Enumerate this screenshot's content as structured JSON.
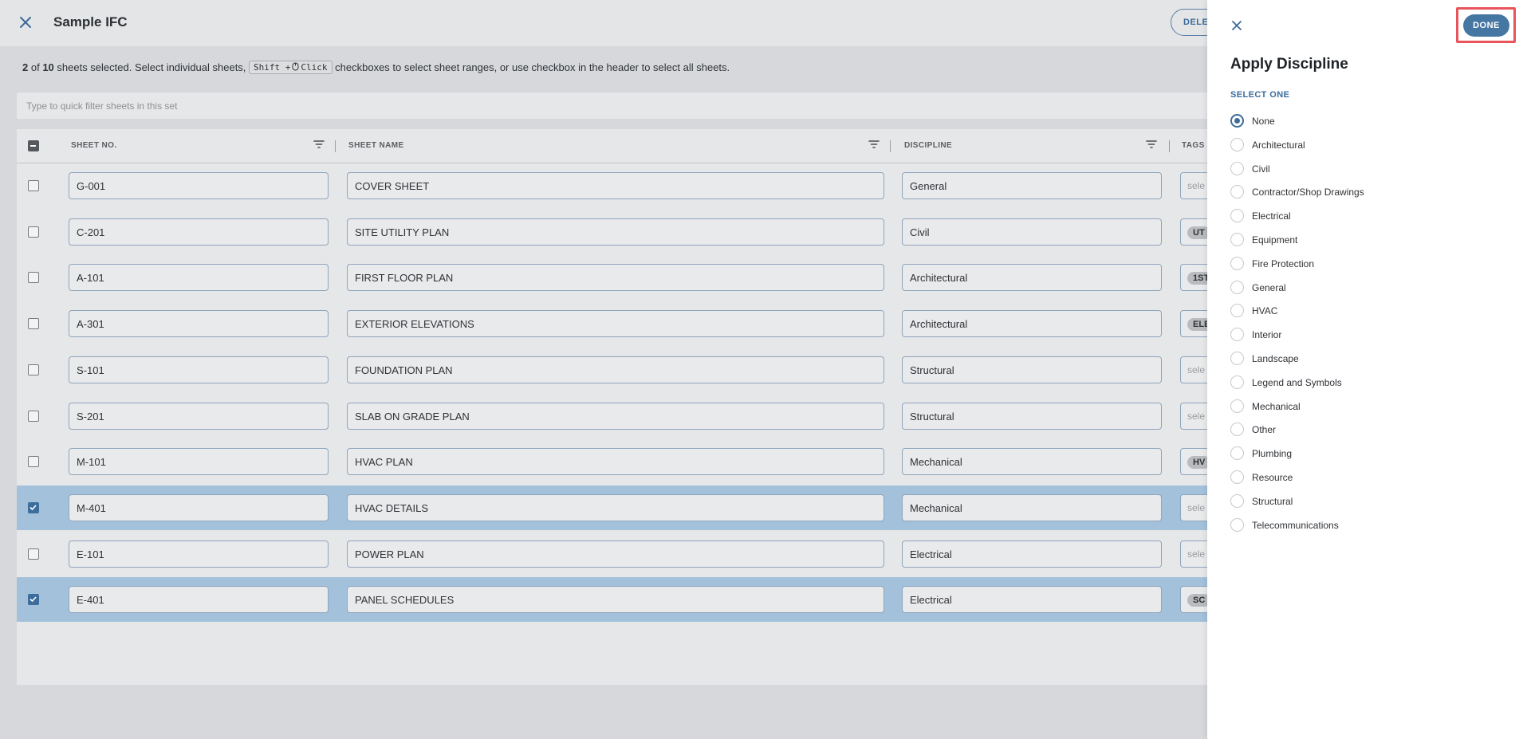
{
  "header": {
    "title": "Sample IFC",
    "delete_label": "DELETE"
  },
  "selection": {
    "selected_count": "2",
    "of_text": " of ",
    "total_count": "10",
    "message_part1": " sheets selected. Select individual sheets, ",
    "kbd_shift": "Shift +",
    "kbd_click": "Click",
    "message_part2": " checkboxes to select sheet ranges, or use checkbox in the header to select all sheets."
  },
  "filter": {
    "placeholder": "Type to quick filter sheets in this set"
  },
  "table": {
    "columns": {
      "sheet_no": "SHEET NO.",
      "sheet_name": "SHEET NAME",
      "discipline": "DISCIPLINE",
      "tags": "TAGS"
    },
    "rows": [
      {
        "no": "G-001",
        "name": "COVER SHEET",
        "discipline": "General",
        "tag": "sele",
        "tag_is_chip": false,
        "selected": false
      },
      {
        "no": "C-201",
        "name": "SITE UTILITY PLAN",
        "discipline": "Civil",
        "tag": "UT",
        "tag_is_chip": true,
        "selected": false
      },
      {
        "no": "A-101",
        "name": "FIRST FLOOR PLAN",
        "discipline": "Architectural",
        "tag": "1ST",
        "tag_is_chip": true,
        "selected": false
      },
      {
        "no": "A-301",
        "name": "EXTERIOR ELEVATIONS",
        "discipline": "Architectural",
        "tag": "ELE",
        "tag_is_chip": true,
        "selected": false
      },
      {
        "no": "S-101",
        "name": "FOUNDATION PLAN",
        "discipline": "Structural",
        "tag": "sele",
        "tag_is_chip": false,
        "selected": false
      },
      {
        "no": "S-201",
        "name": "SLAB ON GRADE PLAN",
        "discipline": "Structural",
        "tag": "sele",
        "tag_is_chip": false,
        "selected": false
      },
      {
        "no": "M-101",
        "name": "HVAC PLAN",
        "discipline": "Mechanical",
        "tag": "HV",
        "tag_is_chip": true,
        "selected": false
      },
      {
        "no": "M-401",
        "name": "HVAC DETAILS",
        "discipline": "Mechanical",
        "tag": "sele",
        "tag_is_chip": false,
        "selected": true
      },
      {
        "no": "E-101",
        "name": "POWER PLAN",
        "discipline": "Electrical",
        "tag": "sele",
        "tag_is_chip": false,
        "selected": false
      },
      {
        "no": "E-401",
        "name": "PANEL SCHEDULES",
        "discipline": "Electrical",
        "tag": "SC",
        "tag_is_chip": true,
        "selected": true
      }
    ]
  },
  "panel": {
    "title": "Apply Discipline",
    "select_one": "SELECT ONE",
    "done_label": "DONE",
    "selected_option": "None",
    "options": [
      "None",
      "Architectural",
      "Civil",
      "Contractor/Shop Drawings",
      "Electrical",
      "Equipment",
      "Fire Protection",
      "General",
      "HVAC",
      "Interior",
      "Landscape",
      "Legend and Symbols",
      "Mechanical",
      "Other",
      "Plumbing",
      "Resource",
      "Structural",
      "Telecommunications"
    ]
  },
  "colors": {
    "accent": "#3c6d9b",
    "annotation": "#e8545a",
    "selected_row": "#a3c1db"
  }
}
